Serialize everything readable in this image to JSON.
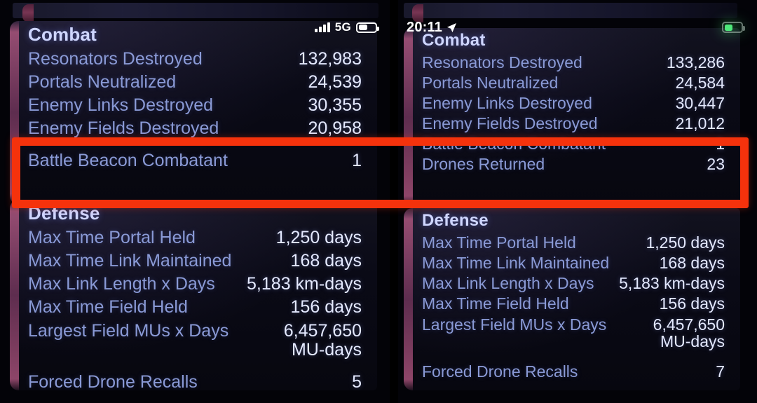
{
  "left_screenshot": {
    "status_bar": {
      "signal_icon": "signal-bars-icon",
      "network_label": "5G",
      "battery_icon": "battery-icon"
    },
    "combat": {
      "title": "Combat",
      "rows": [
        {
          "label": "Resonators Destroyed",
          "value": "132,983"
        },
        {
          "label": "Portals Neutralized",
          "value": "24,539"
        },
        {
          "label": "Enemy Links Destroyed",
          "value": "30,355"
        },
        {
          "label": "Enemy Fields Destroyed",
          "value": "20,958"
        },
        {
          "label": "Battle Beacon Combatant",
          "value": "1"
        }
      ]
    },
    "defense": {
      "title": "Defense",
      "rows": [
        {
          "label": "Max Time Portal Held",
          "value": "1,250 days"
        },
        {
          "label": "Max Time Link Maintained",
          "value": "168 days"
        },
        {
          "label": "Max Link Length x Days",
          "value": "5,183 km-days"
        },
        {
          "label": "Max Time Field Held",
          "value": "156 days"
        },
        {
          "label": "Largest Field MUs x Days",
          "value": "6,457,650 MU-days"
        },
        {
          "label": "Forced Drone Recalls",
          "value": "5"
        }
      ]
    }
  },
  "right_screenshot": {
    "status_bar": {
      "time": "20:11",
      "location_icon": "location-arrow-icon",
      "battery_icon": "battery-icon-green"
    },
    "combat": {
      "title": "Combat",
      "rows": [
        {
          "label": "Resonators Destroyed",
          "value": "133,286"
        },
        {
          "label": "Portals Neutralized",
          "value": "24,584"
        },
        {
          "label": "Enemy Links Destroyed",
          "value": "30,447"
        },
        {
          "label": "Enemy Fields Destroyed",
          "value": "21,012"
        },
        {
          "label": "Battle Beacon Combatant",
          "value": "1"
        },
        {
          "label": "Drones Returned",
          "value": "23"
        }
      ]
    },
    "defense": {
      "title": "Defense",
      "rows": [
        {
          "label": "Max Time Portal Held",
          "value": "1,250 days"
        },
        {
          "label": "Max Time Link Maintained",
          "value": "168 days"
        },
        {
          "label": "Max Link Length x Days",
          "value": "5,183 km-days"
        },
        {
          "label": "Max Time Field Held",
          "value": "156 days"
        },
        {
          "label": "Largest Field MUs x Days",
          "value": "6,457,650 MU-days"
        },
        {
          "label": "Forced Drone Recalls",
          "value": "7"
        }
      ]
    }
  },
  "annotation": {
    "name": "red-highlight-rectangle",
    "color": "#f5320c"
  },
  "theme": {
    "background": "#030308",
    "card_background": "#0a0a16",
    "label_color": "#8a9ad6",
    "value_color": "#e4e9ff",
    "title_color": "#cfd6ff",
    "rail_color": "#aa557d",
    "accent_red": "#f5320c",
    "battery_green": "#4ee87a"
  }
}
